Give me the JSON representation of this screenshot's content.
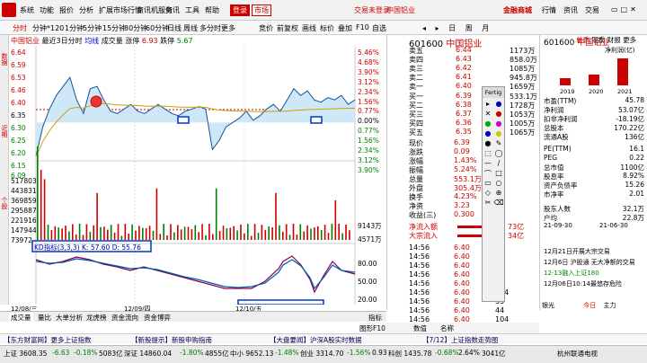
{
  "menubar": {
    "items": [
      "系统",
      "功能",
      "报价",
      "分析",
      "扩展市场行情",
      "资讯机服务",
      "资讯",
      "工具",
      "帮助"
    ],
    "login_btn": "登录",
    "market_btn": "市场",
    "login_tip": "交易未登录",
    "stock_short": "中国铝业",
    "brand": "金融商城",
    "right_items": [
      "行情",
      "资讯",
      "交易"
    ]
  },
  "toolbar": {
    "items": [
      "分时",
      "分钟*120",
      "1分钟",
      "5分钟",
      "15分钟",
      "30分钟",
      "60分钟",
      "日线",
      "周线",
      "多分时",
      "更多"
    ],
    "right": [
      "竞价",
      "前复权",
      "画线",
      "标价",
      "叠加",
      "F10",
      "自选"
    ]
  },
  "sidetabs": [
    "数据",
    "近期",
    "个股"
  ],
  "chart": {
    "title": "中国铝业",
    "subtitle": "最近3日分时",
    "mode": "均线",
    "vol_label": "成交量",
    "rise_label": "涨停",
    "rise_val": "6.93",
    "fall_label": "跌停",
    "fall_val": "5.67",
    "indicator_label": "KD指标(3,3,3) K: 57.60 D: 55.76",
    "date1": "12/08/三",
    "date2": "12/09/四",
    "date3": "12/10/五",
    "left_prices": [
      "6.64",
      "6.59",
      "6.53",
      "6.46",
      "6.40",
      "6.35",
      "6.30",
      "6.25",
      "6.20",
      "6.15",
      "6.09"
    ],
    "right_pcts": [
      "5.46%",
      "4.68%",
      "3.90%",
      "3.12%",
      "2.34%",
      "1.56%",
      "0.77%",
      "0.00%",
      "0.77%",
      "1.56%",
      "2.34%",
      "3.12%",
      "3.90%"
    ],
    "vol_left": [
      "517803",
      "443831",
      "369859",
      "295887",
      "221916",
      "147944",
      "73972"
    ],
    "vol_right": [
      "9143万",
      "4571万"
    ],
    "kd_levels": [
      "80.00",
      "50.00",
      "20.00"
    ],
    "chart_data": {
      "type": "line",
      "series": [
        {
          "values": [
            6.15,
            6.28,
            6.36,
            6.42,
            6.46,
            6.5,
            6.4,
            6.34,
            6.45,
            6.46,
            6.4,
            6.35,
            6.34,
            6.36,
            6.38,
            6.35,
            6.34,
            6.36,
            6.38,
            6.36,
            6.34,
            6.33,
            6.35,
            6.36,
            6.37,
            6.36,
            6.18,
            6.22,
            6.28,
            6.3,
            6.32,
            6.35,
            6.31,
            6.33,
            6.36,
            6.38,
            6.35,
            6.4,
            6.45,
            6.42,
            6.44,
            6.4,
            6.39,
            6.41,
            6.4,
            6.42,
            6.38,
            6.4
          ]
        }
      ]
    }
  },
  "quote": {
    "code": "601600",
    "name": "中国铝业",
    "sell_labels": [
      "卖五",
      "卖四",
      "卖三",
      "卖二",
      "卖一"
    ],
    "sell_prices": [
      "6.44",
      "6.43",
      "6.42",
      "6.41",
      "6.40"
    ],
    "sell_vols": [
      "1173万",
      "858.0万",
      "1085万",
      "945.8万",
      "1659万"
    ],
    "buy_labels": [
      "买一",
      "买二",
      "买三",
      "买四",
      "买五"
    ],
    "buy_prices": [
      "6.39",
      "6.38",
      "6.37",
      "6.36",
      "6.35"
    ],
    "buy_vols": [
      "533.1万",
      "1728万",
      "1053万",
      "1005万",
      "1065万"
    ],
    "stats": [
      [
        "现价",
        "6.39"
      ],
      [
        "涨跌",
        "0.09"
      ],
      [
        "涨幅",
        "1.43%"
      ],
      [
        "振幅",
        "5.24%"
      ],
      [
        "总量",
        "553.1万"
      ],
      [
        "外盘",
        "305.4万"
      ],
      [
        "换手",
        "4.23%"
      ],
      [
        "净资",
        "3.23"
      ],
      [
        "收益(三)",
        "0.300"
      ]
    ],
    "flow_labels": [
      "净流入额",
      "大宗流入"
    ],
    "flow_vals": [
      "73亿",
      "34亿"
    ],
    "trades_time": [
      "14:56",
      "14:56",
      "14:56",
      "14:56",
      "14:56",
      "14:56",
      "14:56",
      "14:56",
      "14:56",
      "14:56",
      "15:00"
    ],
    "trades_price": [
      "6.40",
      "6.40",
      "6.40",
      "6.40",
      "6.40",
      "6.40",
      "6.40",
      "6.40",
      "6.40",
      "6.40",
      "6.39"
    ],
    "trades_vol": [
      "98",
      "41",
      "74",
      "53",
      "40",
      "124",
      "35",
      "44",
      "104",
      "24",
      "1626"
    ]
  },
  "tools": {
    "title": "Fertig"
  },
  "right": {
    "code": "601600",
    "name": "中国铝业",
    "tabs": [
      "单季",
      "同季",
      "财报",
      "更多"
    ],
    "profit_label": "净利润(亿)",
    "years": [
      "2019",
      "2020",
      "2021"
    ],
    "fin": [
      [
        "市盈(TTM)",
        "45.78"
      ],
      [
        "净利润",
        "53.07亿"
      ],
      [
        "扣非净利润",
        "-18.19亿"
      ],
      [
        "总股本",
        "170.22亿"
      ],
      [
        "流通A股",
        "136亿"
      ]
    ],
    "fin2": [
      [
        "PE(TTM)",
        "16.1"
      ],
      [
        "PEG",
        "0.22"
      ],
      [
        "总市值",
        "1100亿"
      ],
      [
        "股息率",
        "8.92%"
      ],
      [
        "资产负债率",
        "15.26"
      ],
      [
        "市净率",
        "2.01"
      ]
    ],
    "shareholders": [
      [
        "股东人数",
        "32.1万"
      ],
      [
        "户均",
        "22.8万"
      ]
    ],
    "dates": [
      "21-09-30",
      "21-06-30"
    ],
    "news": [
      "12月21日开展大宗交易",
      "12月6日 沪股通 无大净额的交易",
      "12-13融入上证180",
      "12月06日10:14最悠存危险"
    ],
    "bottom_labels": [
      "银光",
      "今日",
      "主力"
    ]
  },
  "bottomtabs": [
    "成交量",
    "量比",
    "大单分析",
    "龙虎榜",
    "资金流向",
    "资金博弈"
  ],
  "bottom_right": [
    "指标",
    "图形F10",
    "数值",
    "名称"
  ],
  "news_bar": [
    "【东方财富网】更多上证指数",
    "【新股提示】新股申购指南",
    "【大盘要闻】沪深A股实时数据",
    "【7/12】上证指数走势图"
  ],
  "status": {
    "items": [
      "上证 3608.35",
      "-6.63",
      "-0.18%",
      "5083亿",
      "深证 14860.04",
      "-1.80%",
      "4855亿",
      "中小 9652.13",
      "-1.48%",
      "创业 3314.70",
      "-1.56%",
      "0.93",
      "科创 1435.78",
      "-0.68%",
      "2.64%",
      "3041亿"
    ],
    "time": "杭州联通电视"
  }
}
